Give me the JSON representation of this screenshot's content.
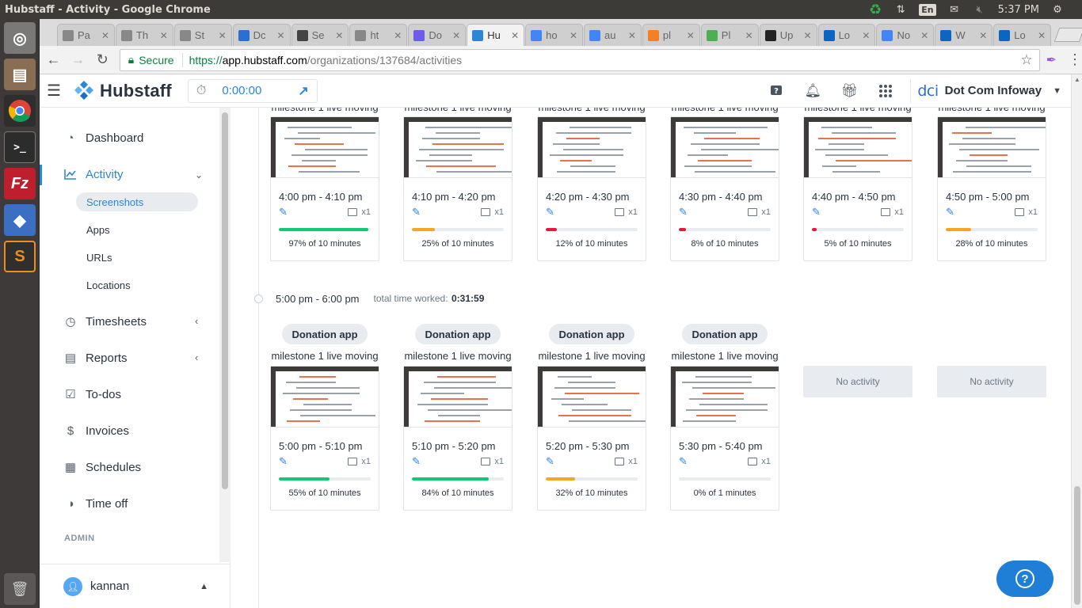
{
  "os": {
    "window_title": "Hubstaff - Activity - Google Chrome",
    "input_lang": "En",
    "clock": "5:37 PM"
  },
  "browser": {
    "tabs": [
      {
        "label": "Pa",
        "color": "#888888"
      },
      {
        "label": "Th",
        "color": "#888888"
      },
      {
        "label": "St",
        "color": "#888888"
      },
      {
        "label": "Dc",
        "color": "#2b6fd6"
      },
      {
        "label": "Se",
        "color": "#444444"
      },
      {
        "label": "ht",
        "color": "#888888"
      },
      {
        "label": "Do",
        "color": "#6c5ce7"
      },
      {
        "label": "Hu",
        "color": "#2b86d9",
        "active": true
      },
      {
        "label": "ho",
        "color": "#4285f4"
      },
      {
        "label": "au",
        "color": "#4285f4"
      },
      {
        "label": "pl",
        "color": "#f48024"
      },
      {
        "label": "Pl",
        "color": "#4caf50"
      },
      {
        "label": "Up",
        "color": "#222222"
      },
      {
        "label": "Lo",
        "color": "#0a66c2"
      },
      {
        "label": "No",
        "color": "#4285f4"
      },
      {
        "label": "W",
        "color": "#0a66c2"
      },
      {
        "label": "Lo",
        "color": "#0a66c2"
      }
    ],
    "secure_label": "Secure",
    "url_scheme": "https://",
    "url_host": "app.hubstaff.com",
    "url_path": "/organizations/137684/activities"
  },
  "header": {
    "brand": "Hubstaff",
    "timer": "0:00:00",
    "org_logo": "dci",
    "org_name": "Dot Com Infoway"
  },
  "sidebar": {
    "items": [
      {
        "label": "Dashboard"
      },
      {
        "label": "Activity"
      },
      {
        "label": "Timesheets"
      },
      {
        "label": "Reports"
      },
      {
        "label": "To-dos"
      },
      {
        "label": "Invoices"
      },
      {
        "label": "Schedules"
      },
      {
        "label": "Time off"
      }
    ],
    "sub_items": [
      {
        "label": "Screenshots"
      },
      {
        "label": "Apps"
      },
      {
        "label": "URLs"
      },
      {
        "label": "Locations"
      }
    ],
    "admin_label": "ADMIN",
    "user": "kannan"
  },
  "main": {
    "top_task_label": "milestone 1 live moving",
    "top_cards": [
      {
        "time": "4:00 pm - 4:10 pm",
        "count": "x1",
        "pct_text": "97% of 10 minutes",
        "pct": 97,
        "color": "#10c876"
      },
      {
        "time": "4:10 pm - 4:20 pm",
        "count": "x1",
        "pct_text": "25% of 10 minutes",
        "pct": 25,
        "color": "#f5a623"
      },
      {
        "time": "4:20 pm - 4:30 pm",
        "count": "x1",
        "pct_text": "12% of 10 minutes",
        "pct": 12,
        "color": "#e5173f"
      },
      {
        "time": "4:30 pm - 4:40 pm",
        "count": "x1",
        "pct_text": "8% of 10 minutes",
        "pct": 8,
        "color": "#e5173f"
      },
      {
        "time": "4:40 pm - 4:50 pm",
        "count": "x1",
        "pct_text": "5% of 10 minutes",
        "pct": 5,
        "color": "#e5173f"
      },
      {
        "time": "4:50 pm - 5:00 pm",
        "count": "x1",
        "pct_text": "28% of 10 minutes",
        "pct": 28,
        "color": "#f5a623"
      }
    ],
    "hour_label": "5:00 pm - 6:00 pm",
    "total_label": "total time worked:",
    "total_value": "0:31:59",
    "project": "Donation app",
    "task": "milestone 1 live moving",
    "bottom_cards": [
      {
        "time": "5:00 pm - 5:10 pm",
        "count": "x1",
        "pct_text": "55% of 10 minutes",
        "pct": 55,
        "color": "#10c876"
      },
      {
        "time": "5:10 pm - 5:20 pm",
        "count": "x1",
        "pct_text": "84% of 10 minutes",
        "pct": 84,
        "color": "#10c876"
      },
      {
        "time": "5:20 pm - 5:30 pm",
        "count": "x1",
        "pct_text": "32% of 10 minutes",
        "pct": 32,
        "color": "#f5a623"
      },
      {
        "time": "5:30 pm - 5:40 pm",
        "count": "x1",
        "pct_text": "0% of 1 minutes",
        "pct": 0,
        "color": "#10c876"
      }
    ],
    "no_activity": "No activity"
  }
}
